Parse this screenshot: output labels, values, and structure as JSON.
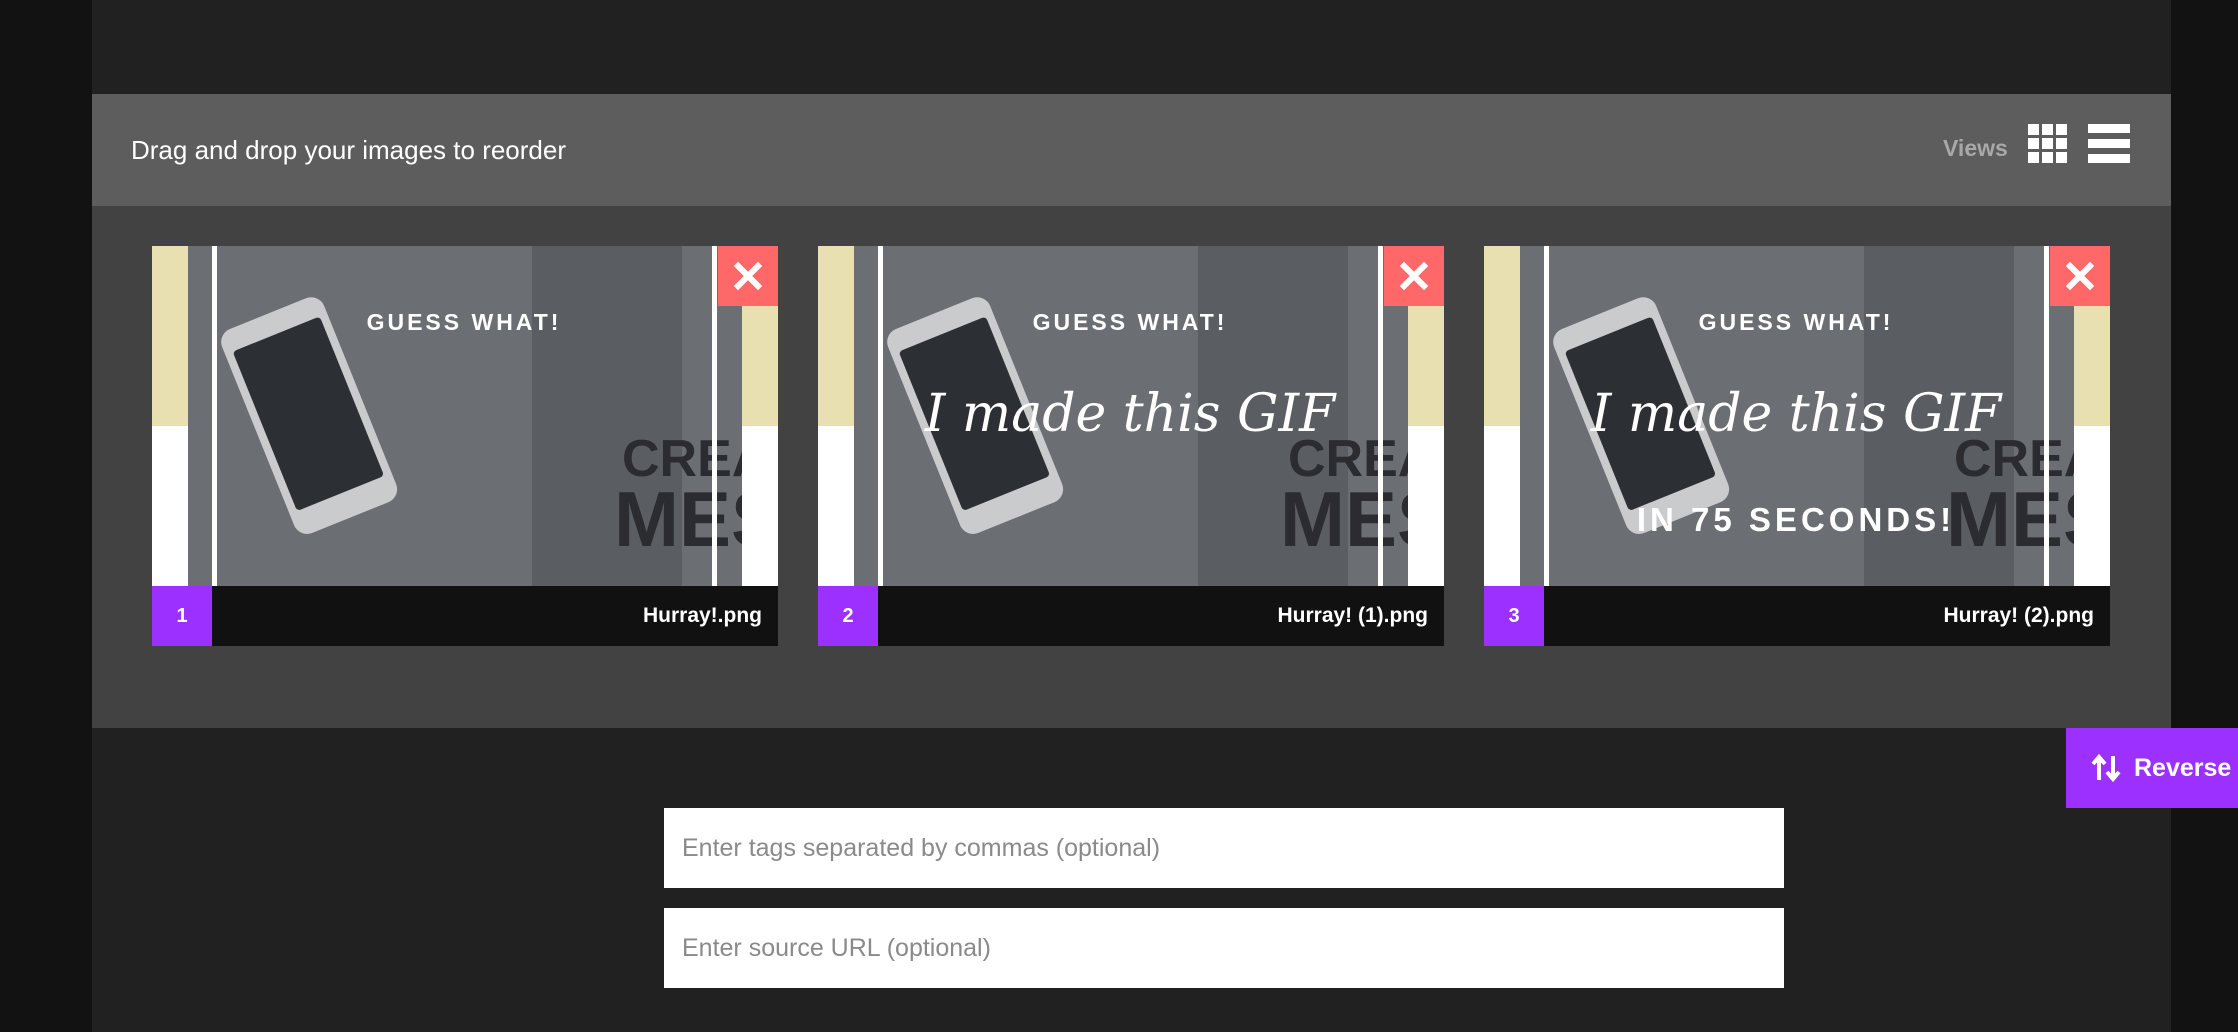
{
  "header": {
    "instruction": "Drag and drop your images to reorder",
    "views_label": "Views",
    "grid_view_icon": "grid-icon",
    "list_view_icon": "list-icon"
  },
  "images": [
    {
      "number": "1",
      "filename": "Hurray!.png",
      "lines": [
        "GUESS WHAT!"
      ],
      "remove_icon": "close-icon"
    },
    {
      "number": "2",
      "filename": "Hurray! (1).png",
      "lines": [
        "GUESS WHAT!",
        "I made this GIF"
      ],
      "remove_icon": "close-icon"
    },
    {
      "number": "3",
      "filename": "Hurray! (2).png",
      "lines": [
        "GUESS WHAT!",
        "I made this GIF",
        "IN 75 SECONDS!"
      ],
      "remove_icon": "close-icon"
    }
  ],
  "thumbnail_background_text": [
    "CREAT",
    "MES"
  ],
  "reverse_button": {
    "label": "Reverse",
    "icon": "sort-arrows-icon"
  },
  "tags_input": {
    "placeholder": "Enter tags separated by commas (optional)",
    "value": ""
  },
  "source_input": {
    "placeholder": "Enter source URL (optional)",
    "value": ""
  },
  "colors": {
    "accent": "#9b30ff",
    "remove": "#ff6868",
    "header_bg": "#5d5d5d",
    "panel_bg": "#424242",
    "page_bg": "#212121",
    "stripe_cream": "#e8e0b0"
  }
}
